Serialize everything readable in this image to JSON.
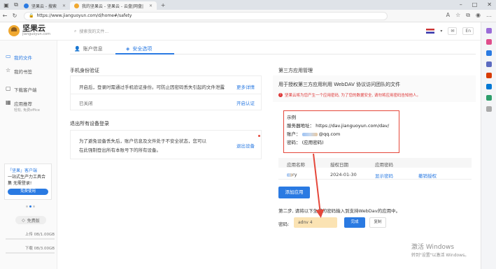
{
  "browser": {
    "tabs": [
      {
        "title": "坚果云 - 搜索",
        "icon_color": "#2a7ae2"
      },
      {
        "title": "我的坚果云 - 坚果云 - 云盘|网盘|",
        "icon_color": "#f0a830"
      }
    ],
    "url": "https://www.jianguoyun.com/d/home#/safety"
  },
  "app": {
    "logo_text": "坚果云",
    "logo_sub": "jianguoyun.com",
    "search_placeholder": "搜索我的文件...",
    "lang_badge": "En"
  },
  "sidebar": {
    "items": [
      {
        "label": "我的文件",
        "icon": "folder-icon",
        "active": true
      },
      {
        "label": "我的书签",
        "icon": "star-icon",
        "active": false
      },
      {
        "label": "下载客户端",
        "icon": "download-icon",
        "active": false
      },
      {
        "label": "应用推荐",
        "sub": "轻松, 免费office",
        "icon": "apps-icon",
        "active": false
      }
    ],
    "promo": {
      "line1": "「坚果」客户端",
      "line2": "一站式生产力工具合",
      "line3": "集 无需登录!",
      "button": "免费使用"
    },
    "free_badge": "免费版",
    "upload": "上传 0B/1.00GB",
    "download": "下载 0B/3.00GB"
  },
  "tabs": {
    "account": "账户信息",
    "security": "安全选项"
  },
  "left": {
    "phone_title": "手机身份验证",
    "phone_desc": "开启后，登录时需通过手机验证身份。可防止因密码丢失引起的文件泄露",
    "more_link": "更多详情",
    "status": "已关闭",
    "enable_link": "开启认证",
    "logout_title": "退出所有设备登录",
    "logout_desc1": "为了避免设备丢失后，账户信息及文件处于不安全状态，您可以",
    "logout_desc2": "在此强制登出所有本账号下的所有设备。",
    "logout_link": "退出设备"
  },
  "right": {
    "title": "第三方应用管理",
    "desc": "用于授权第三方应用利用 WebDAV 协议访问团队的文件",
    "warning": "坚果云将为您产生一个应用密码, 为了您的数据安全, 请勿将应用密码告知他人。",
    "example_label": "示例",
    "server_label": "服务器地址：",
    "server_value": "https://dav.jianguoyun.com/dav/",
    "account_label": "账户：",
    "account_value": "@qq.com",
    "password_label": "密码：",
    "password_value": "(应用密码)",
    "columns": [
      "应用名称",
      "授权日期",
      "应用密码",
      ""
    ],
    "rows": [
      {
        "name": "ry",
        "date": "2024-01-30",
        "show": "显示密码",
        "revoke": "撤销授权"
      }
    ],
    "add_button": "添加应用",
    "step2": "第二步, 请将以下生成的密码输入到支持WebDav的应用中。",
    "pw_label": "密码:",
    "pw_value": "adnv 4",
    "done_button": "完成",
    "copy_button": "复制"
  },
  "watermark": {
    "line1": "激活 Windows",
    "line2": "转到\"设置\"以激活 Windows。"
  },
  "colors": {
    "accent": "#2a7ae2",
    "highlight": "#e5473a",
    "logo": "#f0a830"
  }
}
